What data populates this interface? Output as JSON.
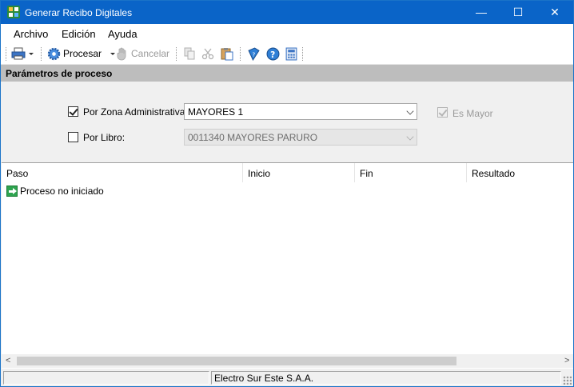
{
  "window": {
    "title": "Generar Recibo Digitales",
    "controls": {
      "minimize": "—",
      "maximize": "☐",
      "close": "✕"
    }
  },
  "menu": {
    "items": [
      "Archivo",
      "Edición",
      "Ayuda"
    ]
  },
  "toolbar": {
    "print_icon": "printer-icon",
    "process_label": "Procesar",
    "cancel_label": "Cancelar"
  },
  "section": {
    "title": "Parámetros de proceso"
  },
  "params": {
    "zona": {
      "label": "Por Zona Administrativa:",
      "checked": true,
      "value": "MAYORES 1"
    },
    "es_mayor": {
      "label": "Es Mayor",
      "checked": true,
      "enabled": false
    },
    "libro": {
      "label": "Por Libro:",
      "checked": false,
      "value": "0011340 MAYORES PARURO",
      "enabled": false
    }
  },
  "grid": {
    "columns": [
      "Paso",
      "Inicio",
      "Fin",
      "Resultado"
    ],
    "rows": [
      {
        "paso": "Proceso no iniciado",
        "inicio": "",
        "fin": "",
        "resultado": ""
      }
    ]
  },
  "statusbar": {
    "panels": [
      "",
      "Electro Sur Este S.A.A."
    ]
  },
  "colors": {
    "titlebar": "#0a64c8",
    "section_header": "#bdbdbd",
    "status_icon": "#2ea44f"
  }
}
